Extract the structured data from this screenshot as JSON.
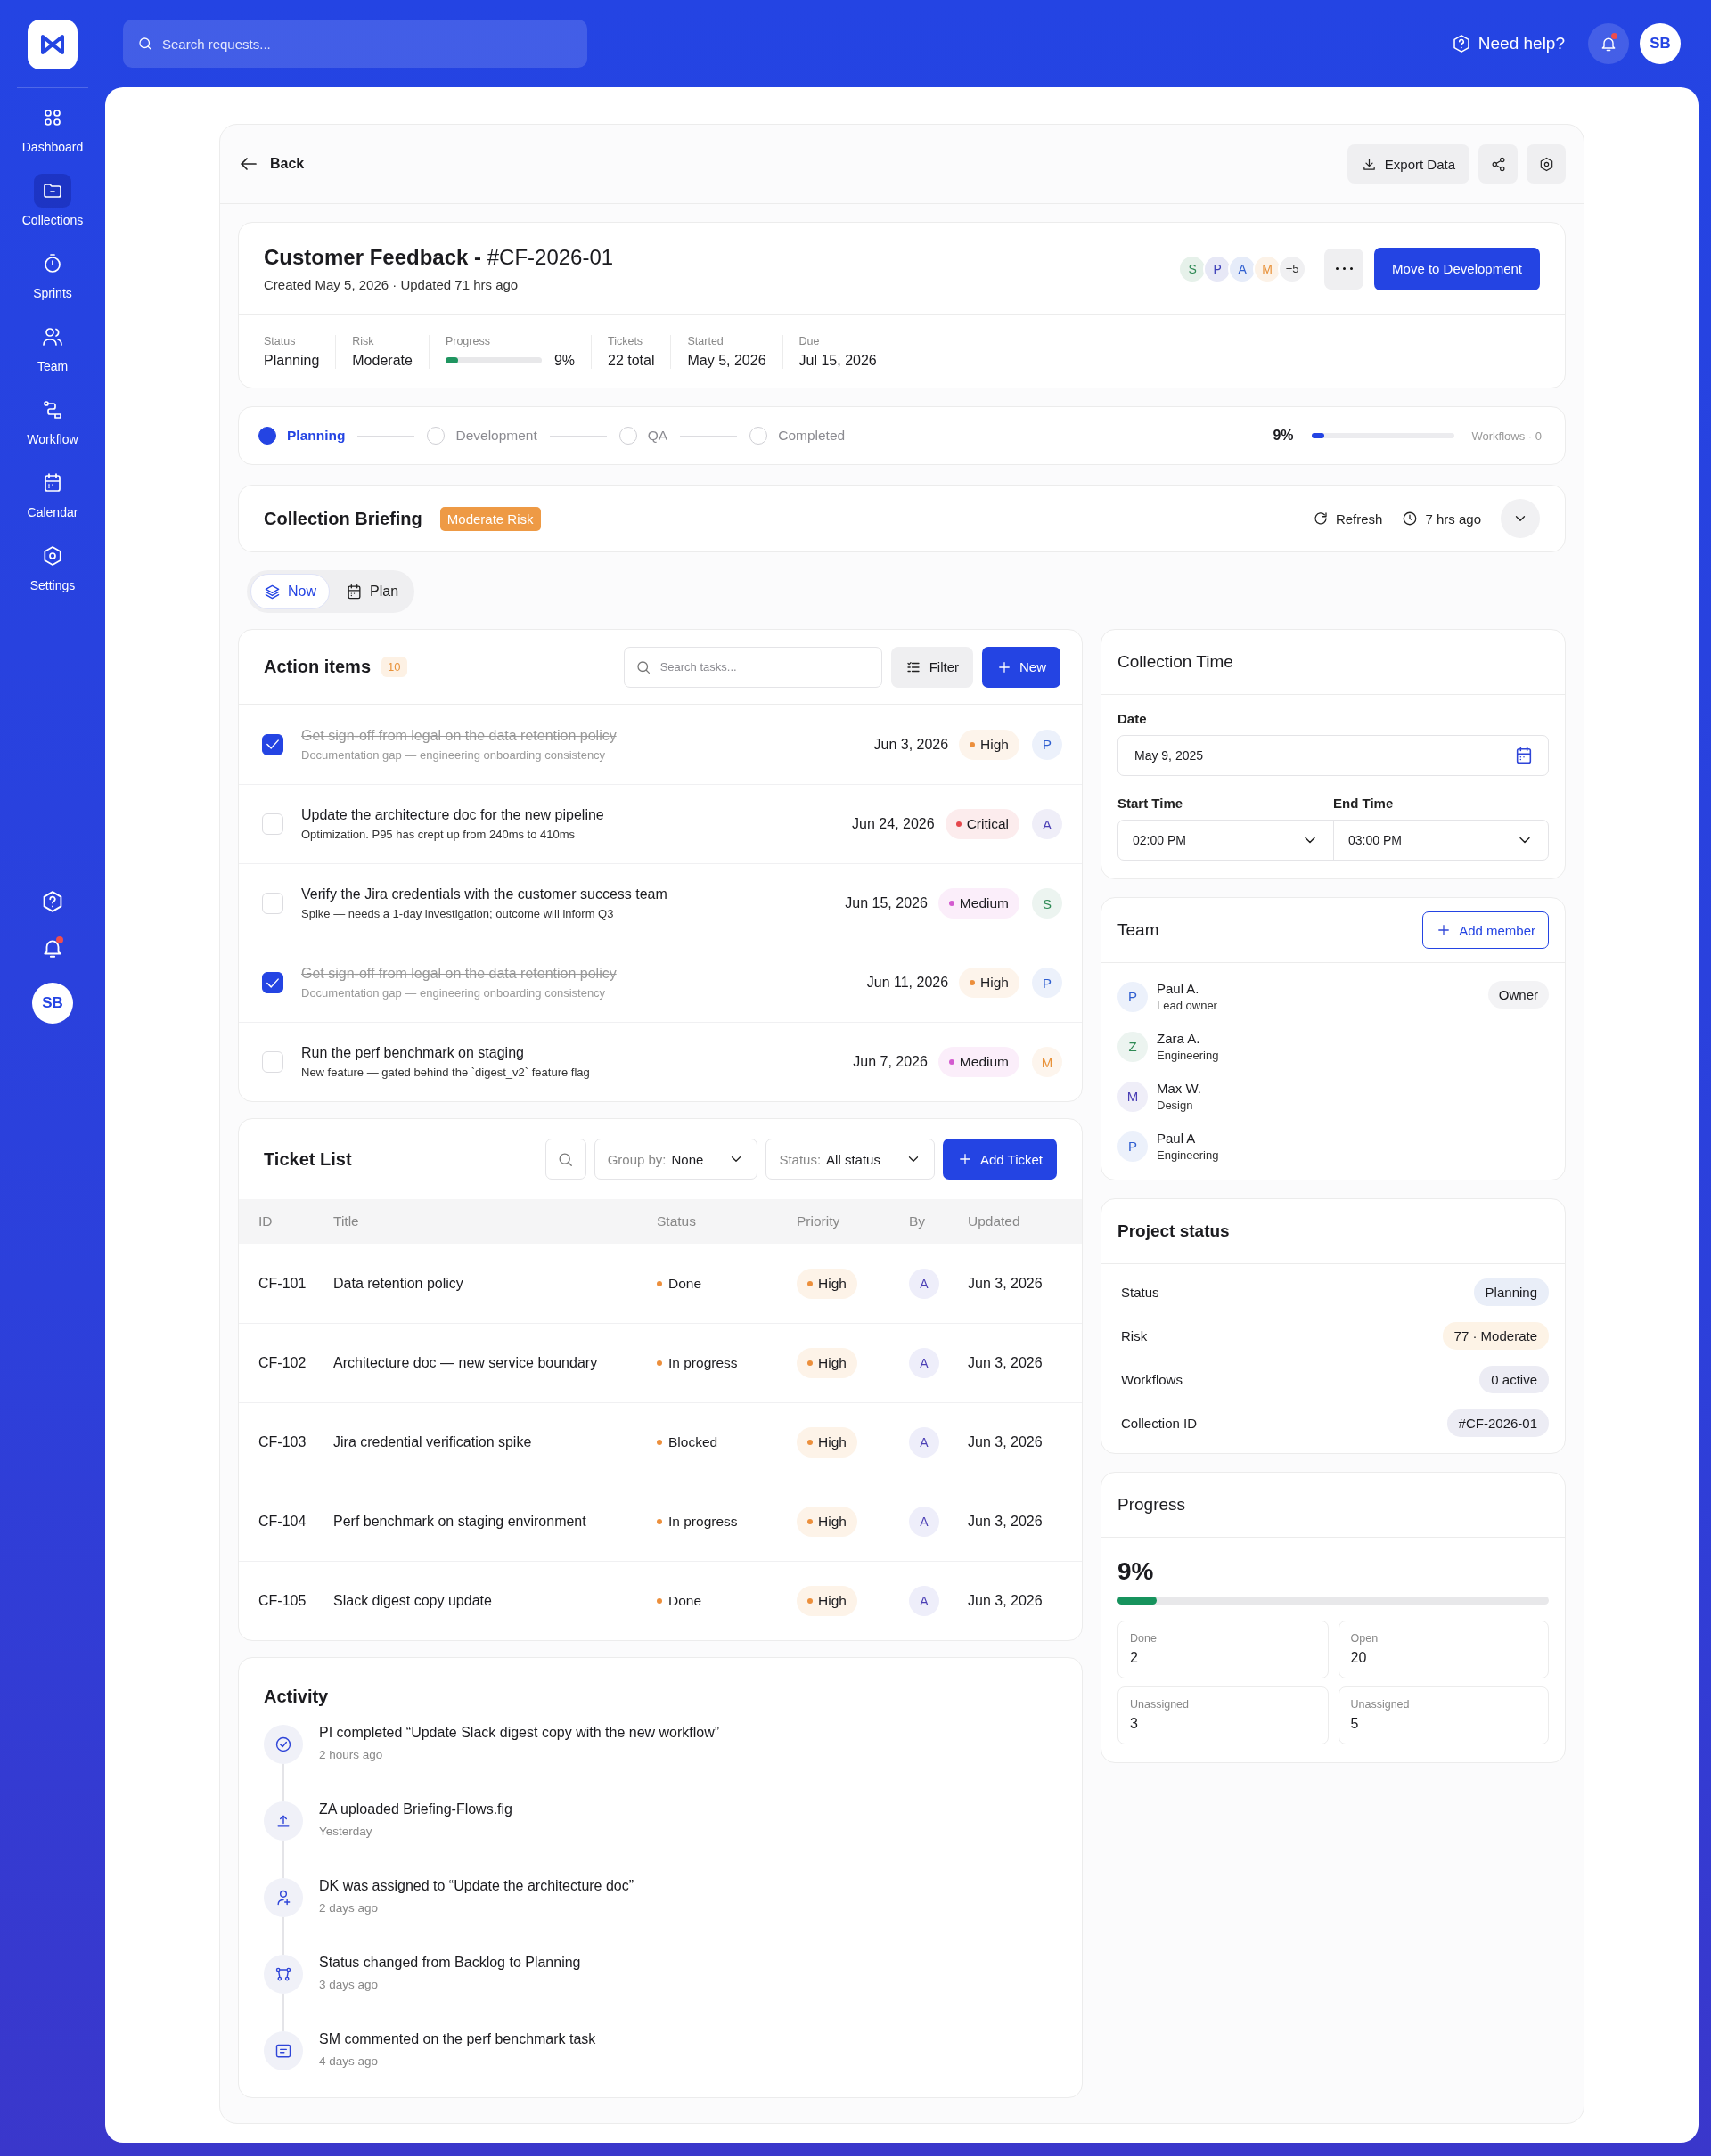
{
  "sidebar": {
    "items": [
      {
        "label": "Dashboard",
        "selected": false
      },
      {
        "label": "Collections",
        "selected": true
      },
      {
        "label": "Sprints",
        "selected": false
      },
      {
        "label": "Team",
        "selected": false
      },
      {
        "label": "Workflow",
        "selected": false
      },
      {
        "label": "Calendar",
        "selected": false
      },
      {
        "label": "Settings",
        "selected": false
      }
    ],
    "unread": true,
    "avatar": "SB"
  },
  "top_bar": {
    "search": {
      "placeholder": "Search requests..."
    },
    "help": "Need help?",
    "unread": true,
    "avatar": "SB"
  },
  "toolbar": {
    "back": "Back",
    "export": "Export Data"
  },
  "project": {
    "title": "**Customer Feedback -** #CF-2026-01",
    "subtitle": "Created May 5, 2026 · Updated 71 hrs ago",
    "avatars": [
      {
        "initial": "S",
        "color": "#2f8a55"
      },
      {
        "initial": "P",
        "color": "#3d3fb8"
      },
      {
        "initial": "A",
        "color": "#2f5fd0"
      },
      {
        "initial": "M",
        "color": "#e8923a"
      }
    ],
    "more_count": "+5",
    "primary": "Move to Development",
    "stats": [
      {
        "kind": "text",
        "label": "Status",
        "value": "Planning"
      },
      {
        "kind": "text",
        "label": "Risk",
        "value": "Moderate"
      },
      {
        "kind": "progress",
        "label": "Progress",
        "value": "9%",
        "level": 0.09
      },
      {
        "kind": "text",
        "label": "Tickets",
        "value": "22 total"
      },
      {
        "kind": "text",
        "label": "Started",
        "value": "May 5, 2026"
      },
      {
        "kind": "text",
        "label": "Due",
        "value": "Jul 15, 2026"
      }
    ]
  },
  "stepper": {
    "steps": [
      {
        "label": "Planning",
        "selected": true
      },
      {
        "label": "Development",
        "selected": false
      },
      {
        "label": "QA",
        "selected": false
      },
      {
        "label": "Completed",
        "selected": false
      }
    ],
    "percent": "9%",
    "level": 0.09,
    "workflows": "Workflows · 0"
  },
  "briefing": {
    "title": "Collection Briefing",
    "badge": "Moderate Risk",
    "refresh": "Refresh",
    "updated": "7 hrs ago"
  },
  "view_toggle": [
    {
      "label": "Now",
      "selected": true
    },
    {
      "label": "Plan",
      "selected": false
    }
  ],
  "action_items": {
    "title": "Action items",
    "count": "10",
    "search": {
      "placeholder": "Search tasks..."
    },
    "filter": "Filter",
    "new": "New",
    "items": [
      {
        "title": "Get sign-off from legal on the data retention policy",
        "subtitle": "Documentation gap — engineering onboarding consistency",
        "checked": true,
        "date": "Jun 3, 2026",
        "priority": {
          "label": "High",
          "color": "#ec8f3c"
        },
        "assignee": {
          "initial": "P",
          "color": "#2f5fd0"
        }
      },
      {
        "title": "Update the architecture doc for the new pipeline",
        "subtitle": "Optimization. P95 has crept up from 240ms to 410ms",
        "checked": false,
        "date": "Jun 24, 2026",
        "priority": {
          "label": "Critical",
          "color": "#e5484d"
        },
        "assignee": {
          "initial": "A",
          "color": "#4b3fb5"
        }
      },
      {
        "title": "Verify the Jira credentials with the customer success team",
        "subtitle": "Spike — needs a 1-day investigation; outcome will inform Q3",
        "checked": false,
        "date": "Jun 15, 2026",
        "priority": {
          "label": "Medium",
          "color": "#d35bcf"
        },
        "assignee": {
          "initial": "S",
          "color": "#2f8a55"
        }
      },
      {
        "title": "Get sign-off from legal on the data retention policy",
        "subtitle": "Documentation gap — engineering onboarding consistency",
        "checked": true,
        "date": "Jun 11, 2026",
        "priority": {
          "label": "High",
          "color": "#ec8f3c"
        },
        "assignee": {
          "initial": "P",
          "color": "#2f5fd0"
        }
      },
      {
        "title": "Run the perf benchmark on staging",
        "subtitle": "New feature — gated behind the `digest_v2` feature flag",
        "checked": false,
        "date": "Jun 7, 2026",
        "priority": {
          "label": "Medium",
          "color": "#d35bcf"
        },
        "assignee": {
          "initial": "M",
          "color": "#e8923a"
        }
      }
    ]
  },
  "tickets": {
    "title": "Ticket List",
    "group_by": {
      "label": "Group by:",
      "value": "None"
    },
    "status_filter": {
      "label": "Status:",
      "value": "All status"
    },
    "add": "Add Ticket",
    "columns": [
      "ID",
      "Title",
      "Status",
      "Priority",
      "By",
      "Updated"
    ],
    "rows": [
      {
        "id": "CF-101",
        "title": "Data retention policy",
        "status": "Done",
        "priority": "High",
        "by": "A",
        "updated": "Jun 3, 2026"
      },
      {
        "id": "CF-102",
        "title": "Architecture doc — new service boundary",
        "status": "In progress",
        "priority": "High",
        "by": "A",
        "updated": "Jun 3, 2026"
      },
      {
        "id": "CF-103",
        "title": "Jira credential verification spike",
        "status": "Blocked",
        "priority": "High",
        "by": "A",
        "updated": "Jun 3, 2026"
      },
      {
        "id": "CF-104",
        "title": "Perf benchmark on staging environment",
        "status": "In progress",
        "priority": "High",
        "by": "A",
        "updated": "Jun 3, 2026"
      },
      {
        "id": "CF-105",
        "title": "Slack digest copy update",
        "status": "Done",
        "priority": "High",
        "by": "A",
        "updated": "Jun 3, 2026"
      }
    ]
  },
  "activity": {
    "title": "Activity",
    "items": [
      {
        "kind": "complete",
        "text": "PI completed “Update Slack digest copy with the new workflow”",
        "time": "2 hours ago"
      },
      {
        "kind": "upload",
        "text": "ZA uploaded Briefing-Flows.fig",
        "time": "Yesterday"
      },
      {
        "kind": "assign",
        "text": "DK was assigned to “Update the architecture doc”",
        "time": "2 days ago"
      },
      {
        "kind": "status",
        "text": "Status changed from Backlog to Planning",
        "time": "3 days ago"
      },
      {
        "kind": "comment",
        "text": "SM commented on the perf benchmark task",
        "time": "4 days ago"
      }
    ]
  },
  "collection_time": {
    "title": "Collection Time",
    "date": {
      "label": "Date",
      "value": "May 9, 2025"
    },
    "start": {
      "label": "Start Time",
      "value": "02:00 PM"
    },
    "end": {
      "label": "End Time",
      "value": "03:00 PM"
    }
  },
  "team": {
    "title": "Team",
    "add": "Add member",
    "members": [
      {
        "initial": "P",
        "color": "#2f5fd0",
        "name": "Paul A.",
        "role": "Lead owner",
        "badge": "Owner"
      },
      {
        "initial": "Z",
        "color": "#2f8a55",
        "name": "Zara A.",
        "role": "Engineering"
      },
      {
        "initial": "M",
        "color": "#4b3fb5",
        "name": "Max W.",
        "role": "Design"
      },
      {
        "initial": "P",
        "color": "#2f5fd0",
        "name": "Paul A",
        "role": "Engineering"
      }
    ]
  },
  "project_status": {
    "title": "Project status",
    "rows": [
      {
        "label": "Status",
        "value": "Planning",
        "color": "#e9eef8"
      },
      {
        "label": "Risk",
        "value": "77 · Moderate",
        "color": "#fdf3e6"
      },
      {
        "label": "Workflows",
        "value": "0 active",
        "color": "#ececf4"
      },
      {
        "label": "Collection ID",
        "value": "#CF-2026-01",
        "color": "#ececf4"
      }
    ]
  },
  "progress": {
    "title": "Progress",
    "percent": "9%",
    "level": 0.09,
    "stats": [
      {
        "label": "Done",
        "value": "2"
      },
      {
        "label": "Open",
        "value": "20"
      },
      {
        "label": "Unassigned",
        "value": "3"
      },
      {
        "label": "Unassigned",
        "value": "5"
      }
    ]
  }
}
